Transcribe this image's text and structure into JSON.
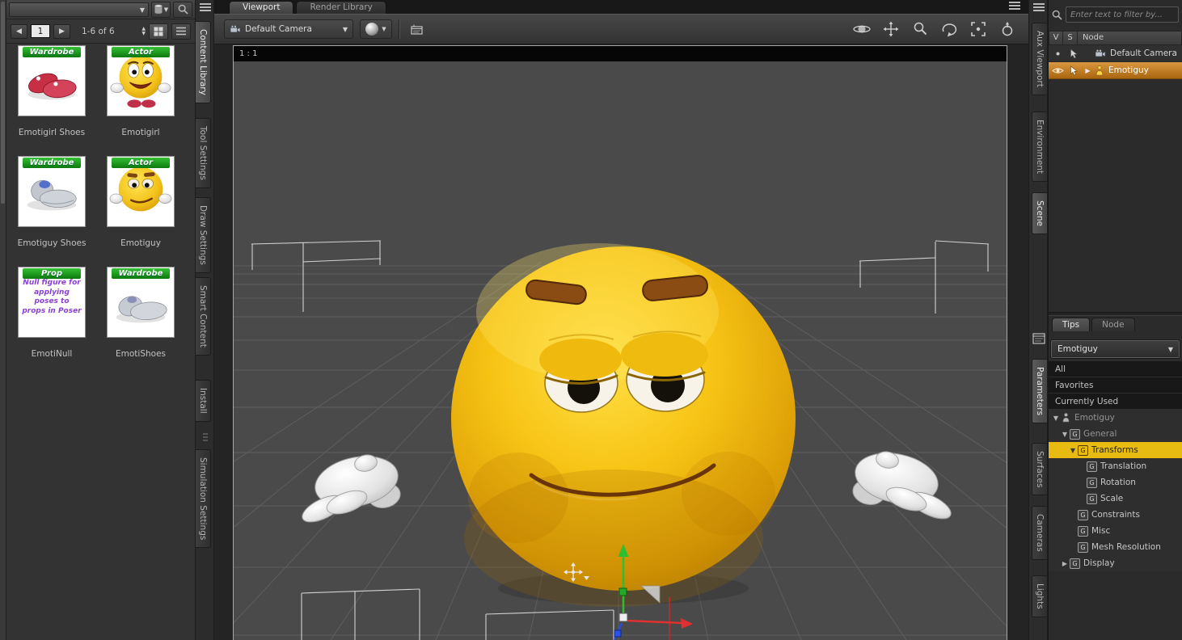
{
  "content_library": {
    "pager": {
      "page": "1",
      "range": "1-6 of 6"
    },
    "items": [
      {
        "name": "Emotigirl Shoes",
        "badge": "Wardrobe"
      },
      {
        "name": "Emotigirl",
        "badge": "Actor"
      },
      {
        "name": "Emotiguy Shoes",
        "badge": "Wardrobe"
      },
      {
        "name": "Emotiguy",
        "badge": "Actor"
      },
      {
        "name": "EmotiNull",
        "badge": "Prop",
        "thumb_text": "Null figure for applying poses to props in Poser"
      },
      {
        "name": "EmotiShoes",
        "badge": "Wardrobe"
      }
    ]
  },
  "left_tabs": {
    "items": [
      "Content Library",
      "Tool Settings",
      "Draw Settings",
      "Smart Content",
      "Install",
      "Simulation Settings"
    ],
    "active": "Content Library"
  },
  "viewport": {
    "tabs": [
      "Viewport",
      "Render Library"
    ],
    "camera": "Default Camera",
    "aspect": "1 : 1"
  },
  "right_tabs": {
    "top": [
      "Aux Viewport",
      "Environment",
      "Scene"
    ],
    "bottom": [
      "Parameters",
      "Surfaces",
      "Cameras",
      "Lights"
    ],
    "active_top": "Scene",
    "active_bottom": "Parameters"
  },
  "scene_pane": {
    "filter_placeholder": "Enter text to filter by...",
    "columns": {
      "v": "V",
      "s": "S",
      "node": "Node"
    },
    "rows": [
      {
        "label": "Default Camera"
      },
      {
        "label": "Emotiguy"
      }
    ],
    "selected_row": "Emotiguy"
  },
  "parameters_pane": {
    "tabs": [
      "Tips",
      "Node"
    ],
    "figure": "Emotiguy",
    "filters": [
      "All",
      "Favorites",
      "Currently Used"
    ],
    "tree": [
      {
        "label": "Emotiguy"
      },
      {
        "label": "General"
      },
      {
        "label": "Transforms"
      },
      {
        "label": "Translation"
      },
      {
        "label": "Rotation"
      },
      {
        "label": "Scale"
      },
      {
        "label": "Constraints"
      },
      {
        "label": "Misc"
      },
      {
        "label": "Mesh Resolution"
      },
      {
        "label": "Display"
      }
    ],
    "selected": "Transforms"
  },
  "colors": {
    "selection_orange": "#c9862f",
    "selection_yellow": "#e7bb12",
    "badge_green": "#17a017"
  }
}
